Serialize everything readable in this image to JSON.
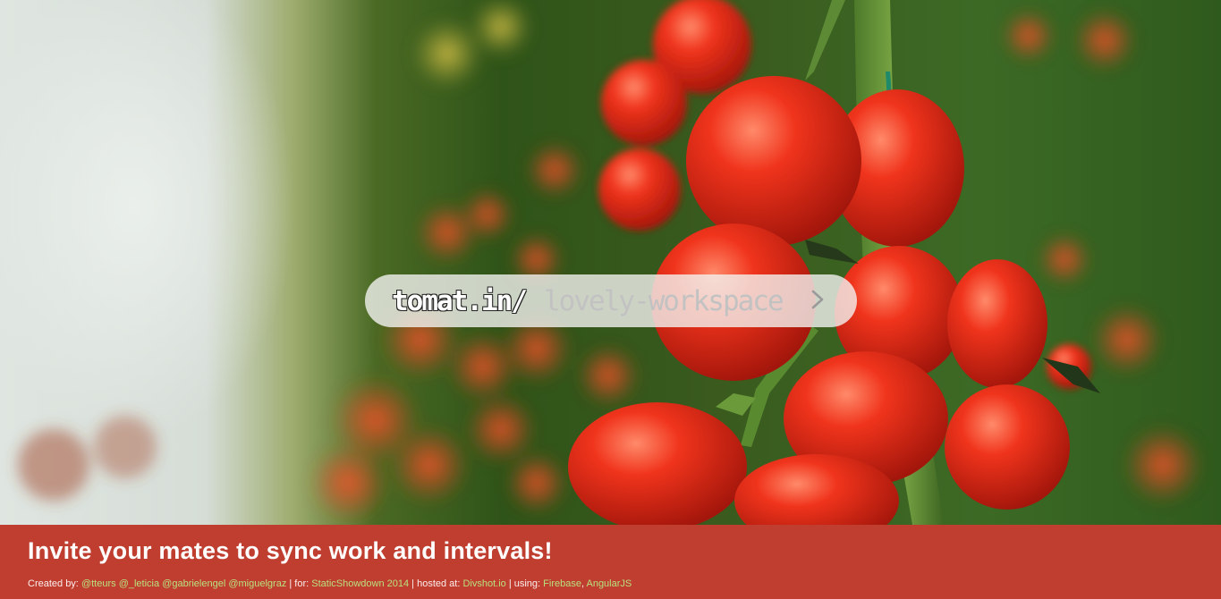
{
  "url_bar": {
    "prefix": "tomat.in/",
    "placeholder": "lovely-workspace",
    "go_icon": "chevron-right-icon"
  },
  "footer": {
    "headline": "Invite your mates to sync work and intervals!",
    "created_by_label": "Created by:",
    "authors": [
      "@tteurs",
      "@_leticia",
      "@gabrielengel",
      "@miguelgraz"
    ],
    "for_label": "| for:",
    "event": "StaticShowdown 2014",
    "hosted_label": "| hosted at:",
    "host": "Divshot.io",
    "using_label": "| using:",
    "tech": [
      "Firebase",
      "AngularJS"
    ],
    "tech_separator": ","
  },
  "colors": {
    "footer_bg": "#c03e30",
    "link": "#b9e07e",
    "input_placeholder": "#c2c2c2"
  }
}
